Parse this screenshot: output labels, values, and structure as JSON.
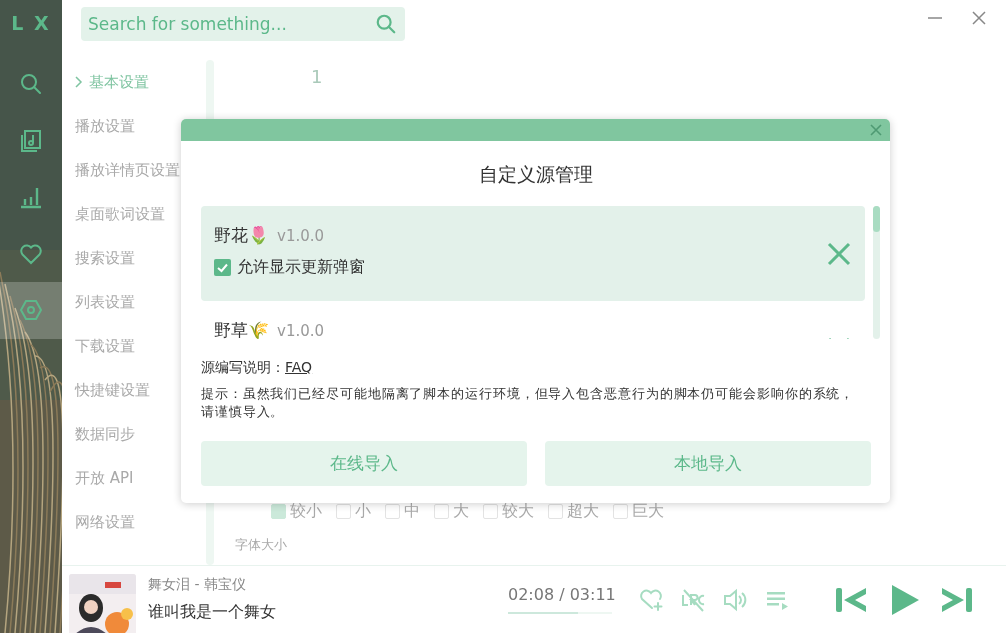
{
  "sidebar": {
    "logo": "L X",
    "items": [
      {
        "kind": "search",
        "selected": false
      },
      {
        "kind": "music",
        "selected": false
      },
      {
        "kind": "chart",
        "selected": false
      },
      {
        "kind": "heart",
        "selected": false
      },
      {
        "kind": "settings",
        "selected": true
      }
    ]
  },
  "search": {
    "placeholder": "Search for something..."
  },
  "settings_nav": [
    {
      "label": "基本设置",
      "selected": true
    },
    {
      "label": "播放设置",
      "selected": false
    },
    {
      "label": "播放详情页设置",
      "selected": false
    },
    {
      "label": "桌面歌词设置",
      "selected": false
    },
    {
      "label": "搜索设置",
      "selected": false
    },
    {
      "label": "列表设置",
      "selected": false
    },
    {
      "label": "下载设置",
      "selected": false
    },
    {
      "label": "快捷键设置",
      "selected": false
    },
    {
      "label": "数据同步",
      "selected": false
    },
    {
      "label": "开放 API",
      "selected": false
    },
    {
      "label": "网络设置",
      "selected": false
    }
  ],
  "content": {
    "tab_label": "1",
    "font_size_options": [
      {
        "label": "较小",
        "checked": true
      },
      {
        "label": "小",
        "checked": false
      },
      {
        "label": "中",
        "checked": false
      },
      {
        "label": "大",
        "checked": false
      },
      {
        "label": "较大",
        "checked": false
      },
      {
        "label": "超大",
        "checked": false
      },
      {
        "label": "巨大",
        "checked": false
      }
    ],
    "section_label": "字体大小"
  },
  "dialog": {
    "title": "自定义源管理",
    "sources": [
      {
        "name": "野花🌷",
        "version": "v1.0.0",
        "selected": true,
        "option": {
          "label": "允许显示更新弹窗",
          "checked": true
        }
      },
      {
        "name": "野草🌾",
        "version": "v1.0.0",
        "selected": false
      }
    ],
    "help_label": "源编写说明：",
    "help_link": "FAQ",
    "hint": "提示：虽然我们已经尽可能地隔离了脚本的运行环境，但导入包含恶意行为的脚本仍可能会影响你的系统，请谨慎导入。",
    "buttons": [
      "在线导入",
      "本地导入"
    ]
  },
  "player": {
    "song": "舞女泪 - 韩宝仪",
    "lyric": "谁叫我是一个舞女",
    "time": "02:08 / 03:11",
    "level": 0.67
  }
}
